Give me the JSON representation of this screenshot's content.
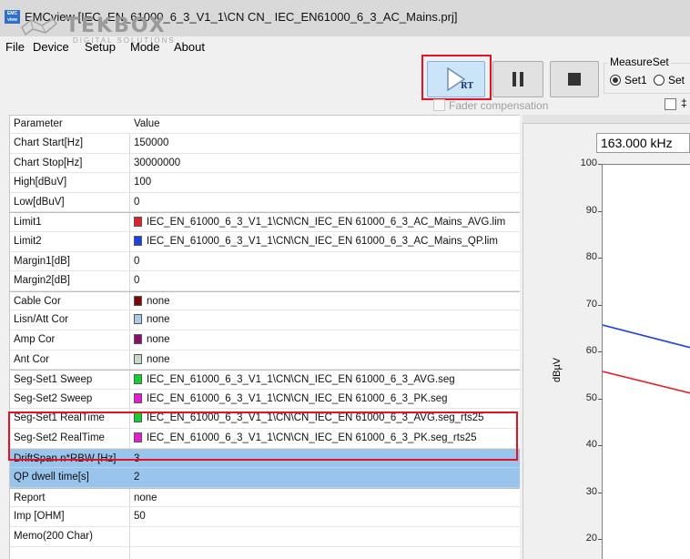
{
  "window": {
    "title": "EMCview [IEC_EN_61000_6_3_V1_1\\CN CN_ IEC_EN61000_6_3_AC_Mains.prj]",
    "icon_text": "EMC view"
  },
  "menu": {
    "items": [
      "File",
      "Device",
      "Setup",
      "Mode",
      "About"
    ]
  },
  "logo": {
    "name": "TEKBOX",
    "tagline": "DIGITAL SOLUTIONS"
  },
  "toolbar": {
    "play_label": "RT",
    "fader_label": "Fader compensation",
    "fader_checked": false
  },
  "measureset": {
    "label": "MeasureSet",
    "options": [
      "Set1",
      "Set"
    ],
    "selected": "Set1",
    "extra_glyph": "‡"
  },
  "grid": {
    "headers": [
      "Parameter",
      "Value"
    ],
    "rows": [
      {
        "param": "Chart Start[Hz]",
        "value": "150000"
      },
      {
        "param": "Chart Stop[Hz]",
        "value": "30000000"
      },
      {
        "param": "High[dBuV]",
        "value": "100"
      },
      {
        "param": "Low[dBuV]",
        "value": "0"
      },
      {
        "param": "Limit1",
        "value": "IEC_EN_61000_6_3_V1_1\\CN\\CN_IEC_EN 61000_6_3_AC_Mains_AVG.lim",
        "color": "#e3202a"
      },
      {
        "param": "Limit2",
        "value": "IEC_EN_61000_6_3_V1_1\\CN\\CN_IEC_EN 61000_6_3_AC_Mains_QP.lim",
        "color": "#1f3fe0"
      },
      {
        "param": "Margin1[dB]",
        "value": "0"
      },
      {
        "param": "Margin2[dB]",
        "value": "0"
      },
      {
        "param": "Cable Cor",
        "value": "none",
        "color": "#7a0a0a"
      },
      {
        "param": "Lisn/Att Cor",
        "value": "none",
        "color": "#a9c9ea"
      },
      {
        "param": "Amp Cor",
        "value": "none",
        "color": "#8a0f6c"
      },
      {
        "param": "Ant Cor",
        "value": "none",
        "color": "#c8d8c8"
      },
      {
        "param": "Seg-Set1 Sweep",
        "value": "IEC_EN_61000_6_3_V1_1\\CN\\CN_IEC_EN 61000_6_3_AVG.seg",
        "color": "#16d02e"
      },
      {
        "param": "Seg-Set2 Sweep",
        "value": "IEC_EN_61000_6_3_V1_1\\CN\\CN_IEC_EN 61000_6_3_PK.seg",
        "color": "#e51bd6"
      },
      {
        "param": "Seg-Set1 RealTime",
        "value": "IEC_EN_61000_6_3_V1_1\\CN\\CN_IEC_EN 61000_6_3_AVG.seg_rts25",
        "color": "#16d02e"
      },
      {
        "param": "Seg-Set2 RealTime",
        "value": "IEC_EN_61000_6_3_V1_1\\CN\\CN_IEC_EN 61000_6_3_PK.seg_rts25",
        "color": "#e51bd6"
      },
      {
        "param": "DriftSpan n*RBW [Hz]",
        "value": "3"
      },
      {
        "param": "QP dwell time[s]",
        "value": "2"
      },
      {
        "param": "Report",
        "value": "none"
      },
      {
        "param": "Imp [OHM]",
        "value": "50"
      },
      {
        "param": "Memo(200 Char)",
        "value": ""
      }
    ]
  },
  "chart": {
    "marker_freq": "163.000 kHz",
    "ylabel": "dBµV",
    "yticks": [
      "100",
      "90",
      "80",
      "70",
      "60",
      "50",
      "40",
      "30",
      "20"
    ],
    "limit_colors": [
      "#e3202a",
      "#1f3fe0"
    ]
  }
}
